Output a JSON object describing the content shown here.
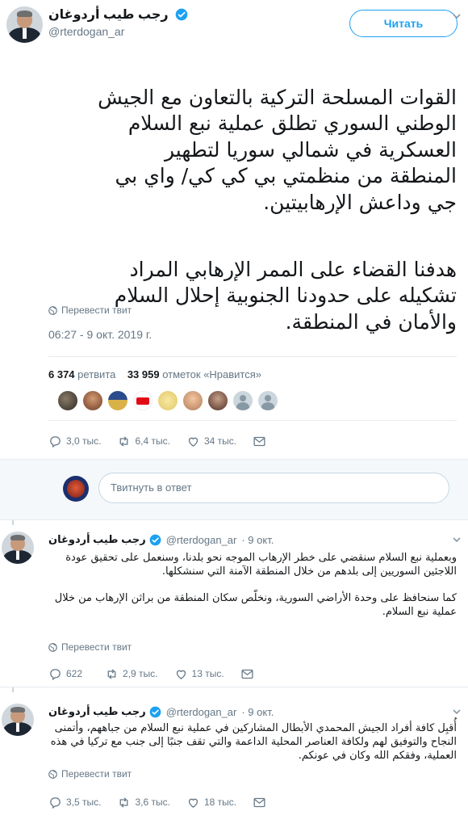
{
  "main_tweet": {
    "author_name": "رجب طيب أردوغان",
    "handle": "@rterdogan_ar",
    "follow_label": "Читать",
    "text_paragraph_1": "القوات المسلحة التركية بالتعاون مع الجيش\nالوطني السوري تطلق عملية نبع السلام\nالعسكرية في شمالي سوريا لتطهير\nالمنطقة من منظمتي بي كي كي/ واي بي\nجي وداعش الإرهابيتين.",
    "text_paragraph_2": "هدفنا القضاء على الممر الإرهابي المراد\nتشكيله على حدودنا الجنوبية إحلال السلام\nوالأمان في المنطقة.",
    "translate_label": "Перевести твит",
    "timestamp": "06:27 - 9 окт. 2019 г.",
    "retweets_count": "6 374",
    "retweets_label": "ретвита",
    "likes_count": "33 959",
    "likes_label": "отметок «Нравится»",
    "replies": "3,0 тыс.",
    "retweets": "6,4 тыс.",
    "likes": "34 тыс."
  },
  "reply_box": {
    "placeholder": "Твитнуть в ответ"
  },
  "thread": [
    {
      "author_name": "رجب طيب أردوغان",
      "handle": "@rterdogan_ar",
      "date": "· 9 окт.",
      "text_1": "وبعملية نبع السلام سنقضي على خطر الإرهاب الموجه نحو بلدنا، وسنعمل على تحقيق عودة اللاجئين السوريين إلى بلدهم من خلال المنطقة الآمنة التي سنشكلها.",
      "text_2": "كما سنحافظ على وحدة الأراضي السورية، ونخلّص سكان المنطقة من براثن الإرهاب من خلال عملية نبع السلام.",
      "translate_label": "Перевести твит",
      "replies": "622",
      "retweets": "2,9 тыс.",
      "likes": "13 тыс."
    },
    {
      "author_name": "رجب طيب أردوغان",
      "handle": "@rterdogan_ar",
      "date": "· 9 окт.",
      "text_1": "أُقبِل كافة أفراد الجيش المحمدي الأبطال المشاركين في عملية نبع السلام من جباههم، وأتمنى النجاح والتوفيق لهم ولكافة العناصر المحلية الداعمة والتي تقف جنبًا إلى جنب مع تركيا في هذه العملية، وفقكم الله وكان في عونكم.",
      "translate_label": "Перевести твит",
      "replies": "3,5 тыс.",
      "retweets": "3,6 тыс.",
      "likes": "18 тыс."
    }
  ],
  "colors": {
    "accent": "#1da1f2",
    "secondary_text": "#657786",
    "border": "#e6ecf0",
    "verified": "#1da1f2"
  },
  "icons": [
    "verified-badge-icon",
    "chevron-down-icon",
    "globe-icon",
    "reply-icon",
    "retweet-icon",
    "like-icon",
    "dm-icon"
  ]
}
